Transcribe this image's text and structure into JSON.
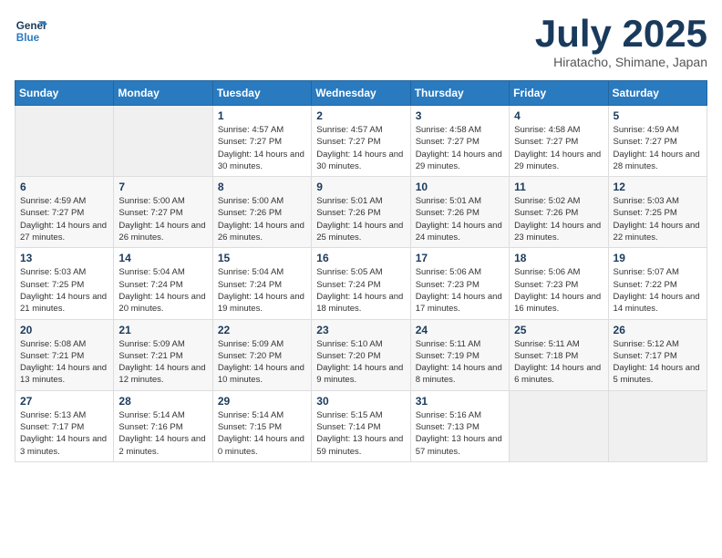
{
  "header": {
    "logo_line1": "General",
    "logo_line2": "Blue",
    "month": "July 2025",
    "location": "Hiratacho, Shimane, Japan"
  },
  "weekdays": [
    "Sunday",
    "Monday",
    "Tuesday",
    "Wednesday",
    "Thursday",
    "Friday",
    "Saturday"
  ],
  "weeks": [
    [
      {
        "day": "",
        "info": ""
      },
      {
        "day": "",
        "info": ""
      },
      {
        "day": "1",
        "info": "Sunrise: 4:57 AM\nSunset: 7:27 PM\nDaylight: 14 hours and 30 minutes."
      },
      {
        "day": "2",
        "info": "Sunrise: 4:57 AM\nSunset: 7:27 PM\nDaylight: 14 hours and 30 minutes."
      },
      {
        "day": "3",
        "info": "Sunrise: 4:58 AM\nSunset: 7:27 PM\nDaylight: 14 hours and 29 minutes."
      },
      {
        "day": "4",
        "info": "Sunrise: 4:58 AM\nSunset: 7:27 PM\nDaylight: 14 hours and 29 minutes."
      },
      {
        "day": "5",
        "info": "Sunrise: 4:59 AM\nSunset: 7:27 PM\nDaylight: 14 hours and 28 minutes."
      }
    ],
    [
      {
        "day": "6",
        "info": "Sunrise: 4:59 AM\nSunset: 7:27 PM\nDaylight: 14 hours and 27 minutes."
      },
      {
        "day": "7",
        "info": "Sunrise: 5:00 AM\nSunset: 7:27 PM\nDaylight: 14 hours and 26 minutes."
      },
      {
        "day": "8",
        "info": "Sunrise: 5:00 AM\nSunset: 7:26 PM\nDaylight: 14 hours and 26 minutes."
      },
      {
        "day": "9",
        "info": "Sunrise: 5:01 AM\nSunset: 7:26 PM\nDaylight: 14 hours and 25 minutes."
      },
      {
        "day": "10",
        "info": "Sunrise: 5:01 AM\nSunset: 7:26 PM\nDaylight: 14 hours and 24 minutes."
      },
      {
        "day": "11",
        "info": "Sunrise: 5:02 AM\nSunset: 7:26 PM\nDaylight: 14 hours and 23 minutes."
      },
      {
        "day": "12",
        "info": "Sunrise: 5:03 AM\nSunset: 7:25 PM\nDaylight: 14 hours and 22 minutes."
      }
    ],
    [
      {
        "day": "13",
        "info": "Sunrise: 5:03 AM\nSunset: 7:25 PM\nDaylight: 14 hours and 21 minutes."
      },
      {
        "day": "14",
        "info": "Sunrise: 5:04 AM\nSunset: 7:24 PM\nDaylight: 14 hours and 20 minutes."
      },
      {
        "day": "15",
        "info": "Sunrise: 5:04 AM\nSunset: 7:24 PM\nDaylight: 14 hours and 19 minutes."
      },
      {
        "day": "16",
        "info": "Sunrise: 5:05 AM\nSunset: 7:24 PM\nDaylight: 14 hours and 18 minutes."
      },
      {
        "day": "17",
        "info": "Sunrise: 5:06 AM\nSunset: 7:23 PM\nDaylight: 14 hours and 17 minutes."
      },
      {
        "day": "18",
        "info": "Sunrise: 5:06 AM\nSunset: 7:23 PM\nDaylight: 14 hours and 16 minutes."
      },
      {
        "day": "19",
        "info": "Sunrise: 5:07 AM\nSunset: 7:22 PM\nDaylight: 14 hours and 14 minutes."
      }
    ],
    [
      {
        "day": "20",
        "info": "Sunrise: 5:08 AM\nSunset: 7:21 PM\nDaylight: 14 hours and 13 minutes."
      },
      {
        "day": "21",
        "info": "Sunrise: 5:09 AM\nSunset: 7:21 PM\nDaylight: 14 hours and 12 minutes."
      },
      {
        "day": "22",
        "info": "Sunrise: 5:09 AM\nSunset: 7:20 PM\nDaylight: 14 hours and 10 minutes."
      },
      {
        "day": "23",
        "info": "Sunrise: 5:10 AM\nSunset: 7:20 PM\nDaylight: 14 hours and 9 minutes."
      },
      {
        "day": "24",
        "info": "Sunrise: 5:11 AM\nSunset: 7:19 PM\nDaylight: 14 hours and 8 minutes."
      },
      {
        "day": "25",
        "info": "Sunrise: 5:11 AM\nSunset: 7:18 PM\nDaylight: 14 hours and 6 minutes."
      },
      {
        "day": "26",
        "info": "Sunrise: 5:12 AM\nSunset: 7:17 PM\nDaylight: 14 hours and 5 minutes."
      }
    ],
    [
      {
        "day": "27",
        "info": "Sunrise: 5:13 AM\nSunset: 7:17 PM\nDaylight: 14 hours and 3 minutes."
      },
      {
        "day": "28",
        "info": "Sunrise: 5:14 AM\nSunset: 7:16 PM\nDaylight: 14 hours and 2 minutes."
      },
      {
        "day": "29",
        "info": "Sunrise: 5:14 AM\nSunset: 7:15 PM\nDaylight: 14 hours and 0 minutes."
      },
      {
        "day": "30",
        "info": "Sunrise: 5:15 AM\nSunset: 7:14 PM\nDaylight: 13 hours and 59 minutes."
      },
      {
        "day": "31",
        "info": "Sunrise: 5:16 AM\nSunset: 7:13 PM\nDaylight: 13 hours and 57 minutes."
      },
      {
        "day": "",
        "info": ""
      },
      {
        "day": "",
        "info": ""
      }
    ]
  ]
}
